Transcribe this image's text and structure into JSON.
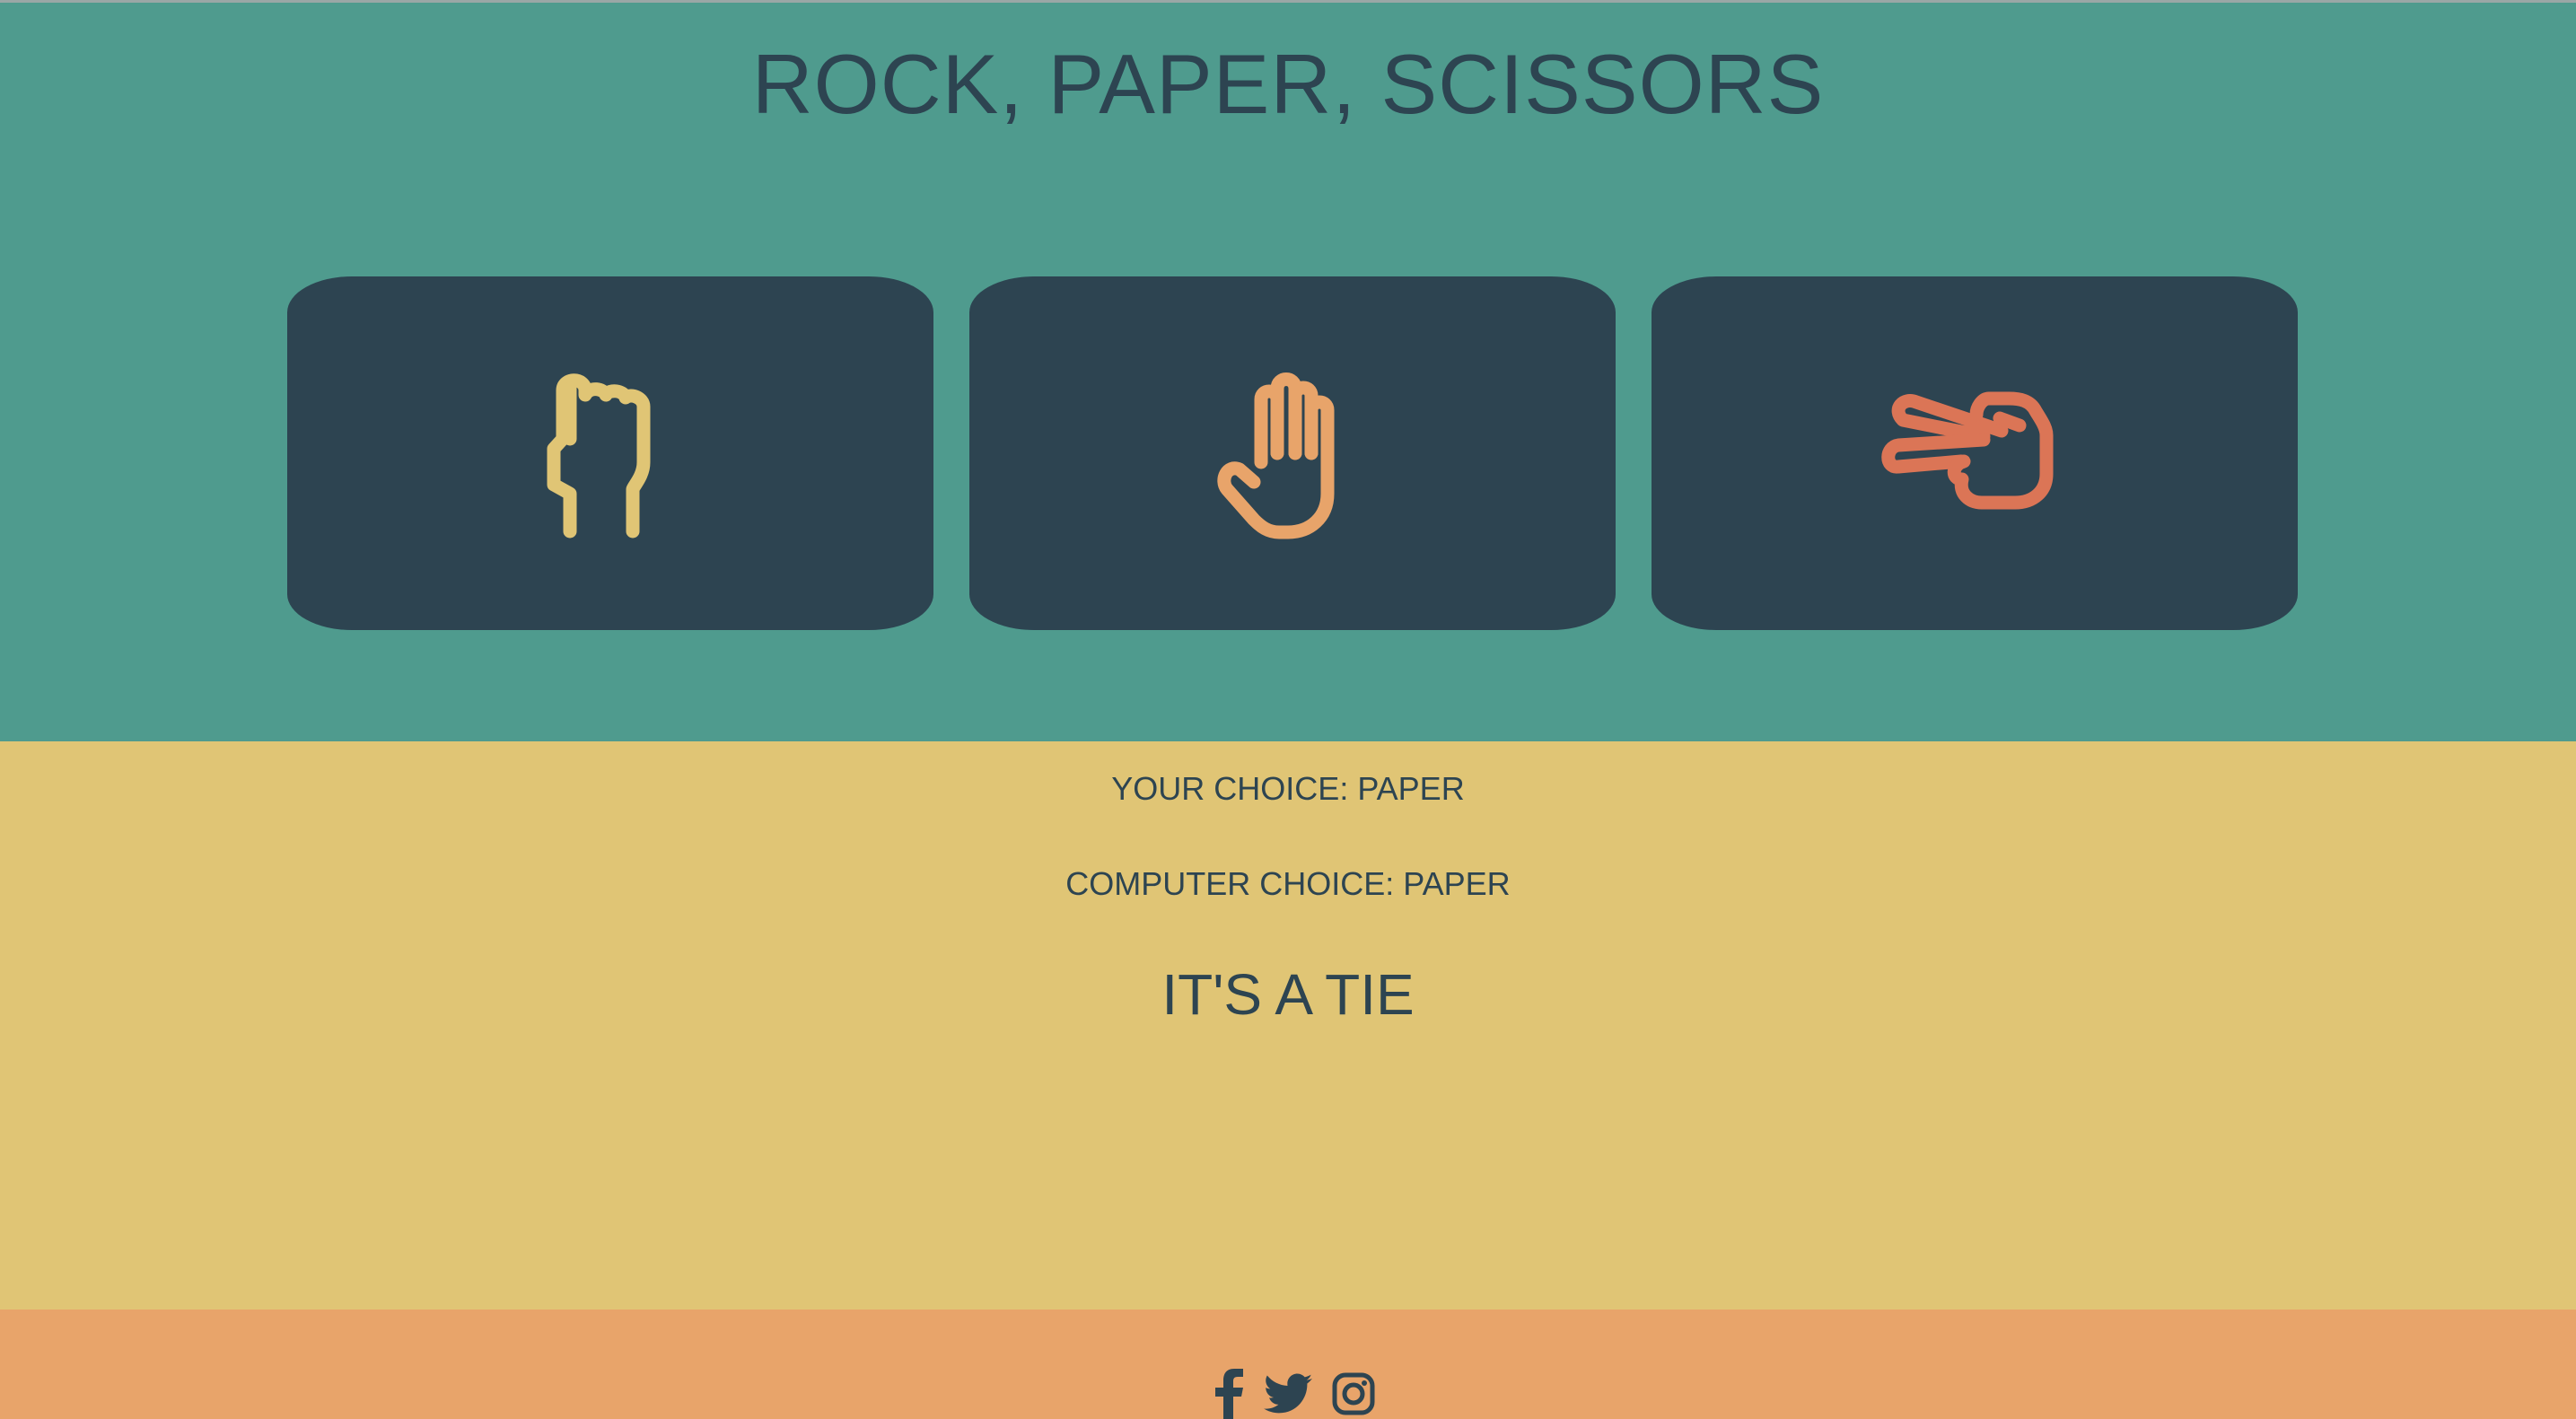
{
  "header": {
    "title": "ROCK, PAPER, SCISSORS"
  },
  "choices": [
    {
      "id": "rock",
      "icon": "rock-fist-icon",
      "color": "#e0c575"
    },
    {
      "id": "paper",
      "icon": "paper-hand-icon",
      "color": "#e8a46a"
    },
    {
      "id": "scissors",
      "icon": "scissors-hand-icon",
      "color": "#db7556"
    }
  ],
  "results": {
    "your_choice": "YOUR CHOICE: PAPER",
    "computer_choice": "COMPUTER CHOICE: PAPER",
    "outcome": "IT'S A TIE"
  },
  "footer": {
    "social": [
      "facebook-icon",
      "twitter-icon",
      "instagram-icon"
    ]
  },
  "colors": {
    "top_bg": "#4f9b8e",
    "card_bg": "#2d4451",
    "result_bg": "#e0c575",
    "footer_bg": "#e8a46a",
    "text": "#2d4451"
  }
}
